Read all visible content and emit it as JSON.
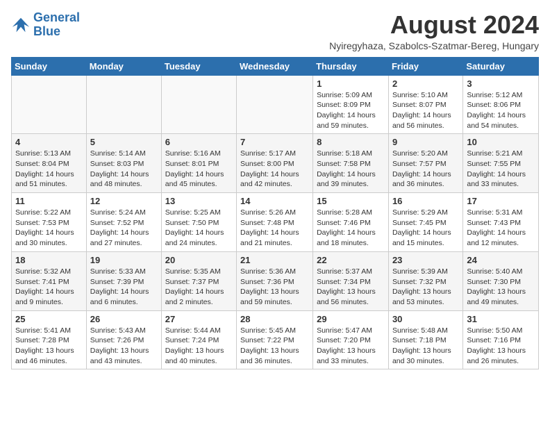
{
  "header": {
    "logo_general": "General",
    "logo_blue": "Blue",
    "month_year": "August 2024",
    "location": "Nyiregyhaza, Szabolcs-Szatmar-Bereg, Hungary"
  },
  "days_of_week": [
    "Sunday",
    "Monday",
    "Tuesday",
    "Wednesday",
    "Thursday",
    "Friday",
    "Saturday"
  ],
  "weeks": [
    [
      {
        "day": "",
        "info": ""
      },
      {
        "day": "",
        "info": ""
      },
      {
        "day": "",
        "info": ""
      },
      {
        "day": "",
        "info": ""
      },
      {
        "day": "1",
        "info": "Sunrise: 5:09 AM\nSunset: 8:09 PM\nDaylight: 14 hours and 59 minutes."
      },
      {
        "day": "2",
        "info": "Sunrise: 5:10 AM\nSunset: 8:07 PM\nDaylight: 14 hours and 56 minutes."
      },
      {
        "day": "3",
        "info": "Sunrise: 5:12 AM\nSunset: 8:06 PM\nDaylight: 14 hours and 54 minutes."
      }
    ],
    [
      {
        "day": "4",
        "info": "Sunrise: 5:13 AM\nSunset: 8:04 PM\nDaylight: 14 hours and 51 minutes."
      },
      {
        "day": "5",
        "info": "Sunrise: 5:14 AM\nSunset: 8:03 PM\nDaylight: 14 hours and 48 minutes."
      },
      {
        "day": "6",
        "info": "Sunrise: 5:16 AM\nSunset: 8:01 PM\nDaylight: 14 hours and 45 minutes."
      },
      {
        "day": "7",
        "info": "Sunrise: 5:17 AM\nSunset: 8:00 PM\nDaylight: 14 hours and 42 minutes."
      },
      {
        "day": "8",
        "info": "Sunrise: 5:18 AM\nSunset: 7:58 PM\nDaylight: 14 hours and 39 minutes."
      },
      {
        "day": "9",
        "info": "Sunrise: 5:20 AM\nSunset: 7:57 PM\nDaylight: 14 hours and 36 minutes."
      },
      {
        "day": "10",
        "info": "Sunrise: 5:21 AM\nSunset: 7:55 PM\nDaylight: 14 hours and 33 minutes."
      }
    ],
    [
      {
        "day": "11",
        "info": "Sunrise: 5:22 AM\nSunset: 7:53 PM\nDaylight: 14 hours and 30 minutes."
      },
      {
        "day": "12",
        "info": "Sunrise: 5:24 AM\nSunset: 7:52 PM\nDaylight: 14 hours and 27 minutes."
      },
      {
        "day": "13",
        "info": "Sunrise: 5:25 AM\nSunset: 7:50 PM\nDaylight: 14 hours and 24 minutes."
      },
      {
        "day": "14",
        "info": "Sunrise: 5:26 AM\nSunset: 7:48 PM\nDaylight: 14 hours and 21 minutes."
      },
      {
        "day": "15",
        "info": "Sunrise: 5:28 AM\nSunset: 7:46 PM\nDaylight: 14 hours and 18 minutes."
      },
      {
        "day": "16",
        "info": "Sunrise: 5:29 AM\nSunset: 7:45 PM\nDaylight: 14 hours and 15 minutes."
      },
      {
        "day": "17",
        "info": "Sunrise: 5:31 AM\nSunset: 7:43 PM\nDaylight: 14 hours and 12 minutes."
      }
    ],
    [
      {
        "day": "18",
        "info": "Sunrise: 5:32 AM\nSunset: 7:41 PM\nDaylight: 14 hours and 9 minutes."
      },
      {
        "day": "19",
        "info": "Sunrise: 5:33 AM\nSunset: 7:39 PM\nDaylight: 14 hours and 6 minutes."
      },
      {
        "day": "20",
        "info": "Sunrise: 5:35 AM\nSunset: 7:37 PM\nDaylight: 14 hours and 2 minutes."
      },
      {
        "day": "21",
        "info": "Sunrise: 5:36 AM\nSunset: 7:36 PM\nDaylight: 13 hours and 59 minutes."
      },
      {
        "day": "22",
        "info": "Sunrise: 5:37 AM\nSunset: 7:34 PM\nDaylight: 13 hours and 56 minutes."
      },
      {
        "day": "23",
        "info": "Sunrise: 5:39 AM\nSunset: 7:32 PM\nDaylight: 13 hours and 53 minutes."
      },
      {
        "day": "24",
        "info": "Sunrise: 5:40 AM\nSunset: 7:30 PM\nDaylight: 13 hours and 49 minutes."
      }
    ],
    [
      {
        "day": "25",
        "info": "Sunrise: 5:41 AM\nSunset: 7:28 PM\nDaylight: 13 hours and 46 minutes."
      },
      {
        "day": "26",
        "info": "Sunrise: 5:43 AM\nSunset: 7:26 PM\nDaylight: 13 hours and 43 minutes."
      },
      {
        "day": "27",
        "info": "Sunrise: 5:44 AM\nSunset: 7:24 PM\nDaylight: 13 hours and 40 minutes."
      },
      {
        "day": "28",
        "info": "Sunrise: 5:45 AM\nSunset: 7:22 PM\nDaylight: 13 hours and 36 minutes."
      },
      {
        "day": "29",
        "info": "Sunrise: 5:47 AM\nSunset: 7:20 PM\nDaylight: 13 hours and 33 minutes."
      },
      {
        "day": "30",
        "info": "Sunrise: 5:48 AM\nSunset: 7:18 PM\nDaylight: 13 hours and 30 minutes."
      },
      {
        "day": "31",
        "info": "Sunrise: 5:50 AM\nSunset: 7:16 PM\nDaylight: 13 hours and 26 minutes."
      }
    ]
  ]
}
